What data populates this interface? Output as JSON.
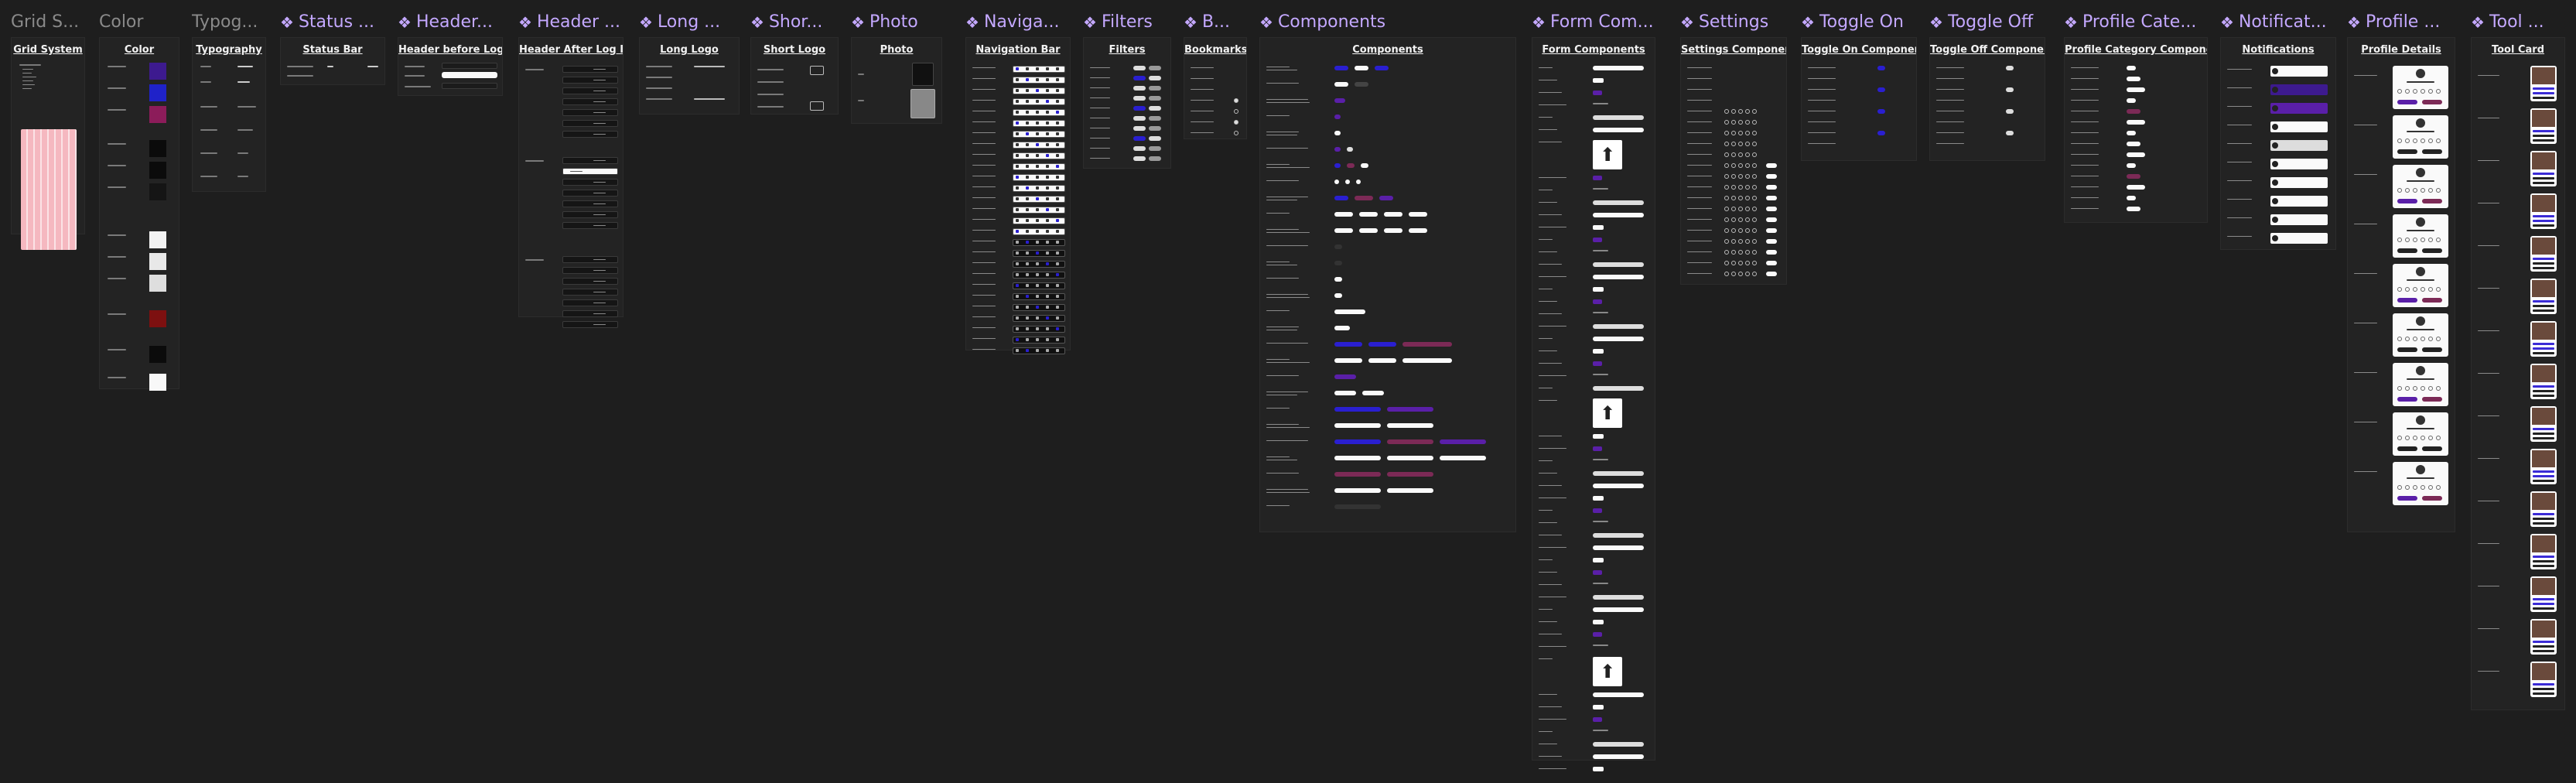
{
  "canvas": {
    "background": "#1e1e1e",
    "accent": "#c4a8ff"
  },
  "sections": [
    {
      "label": "Grid S...",
      "component": false,
      "title": "Grid System"
    },
    {
      "label": "Color",
      "component": false,
      "title": "Color"
    },
    {
      "label": "Typog...",
      "component": false,
      "title": "Typography"
    },
    {
      "label": "Status ...",
      "component": true,
      "title": "Status Bar"
    },
    {
      "label": "Header...",
      "component": true,
      "title": "Header before Log In"
    },
    {
      "label": "Header ...",
      "component": true,
      "title": "Header After Log In"
    },
    {
      "label": "Long ...",
      "component": true,
      "title": "Long Logo"
    },
    {
      "label": "Shor...",
      "component": true,
      "title": "Short Logo"
    },
    {
      "label": "Photo",
      "component": true,
      "title": "Photo"
    },
    {
      "label": "Naviga...",
      "component": true,
      "title": "Navigation Bar"
    },
    {
      "label": "Filters",
      "component": true,
      "title": "Filters"
    },
    {
      "label": "B...",
      "component": true,
      "title": "Bookmarks"
    },
    {
      "label": "Components",
      "component": true,
      "title": "Components"
    },
    {
      "label": "Form Com...",
      "component": true,
      "title": "Form Components"
    },
    {
      "label": "Settings",
      "component": true,
      "title": "Settings Components"
    },
    {
      "label": "Toggle On",
      "component": true,
      "title": "Toggle On Components"
    },
    {
      "label": "Toggle Off",
      "component": true,
      "title": "Toggle Off Components"
    },
    {
      "label": "Profile Cate...",
      "component": true,
      "title": "Profile Category Components"
    },
    {
      "label": "Notificat...",
      "component": true,
      "title": "Notifications"
    },
    {
      "label": "Profile ...",
      "component": true,
      "title": "Profile Details"
    },
    {
      "label": "Tool ...",
      "component": true,
      "title": "Tool Card"
    }
  ],
  "colors": {
    "purple": "#3d1a8f",
    "blue": "#1f22c9",
    "magenta": "#8c1c5a",
    "black": "#0b0b0b",
    "white": "#f2f2f2",
    "red": "#7d1010",
    "pink_grid": "#f5b8c0",
    "button_blue": "#2a1fd0",
    "button_purple": "#5a1fa8",
    "button_magenta": "#7c2a56"
  },
  "icons": {
    "component": "component-diamond-icon",
    "upload": "upload-arrow-icon",
    "avatar": "avatar-person-icon"
  }
}
